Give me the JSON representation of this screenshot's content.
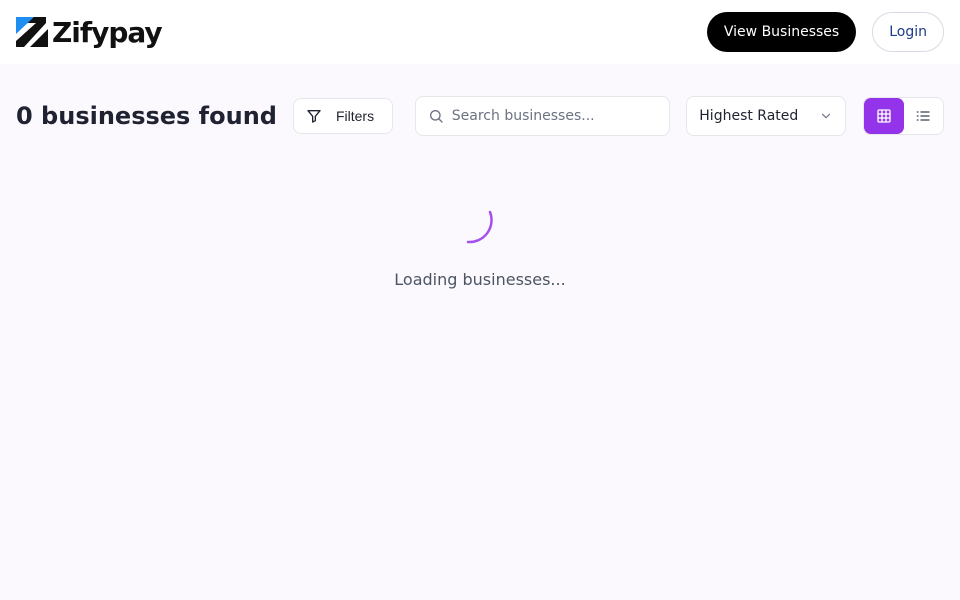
{
  "brand": {
    "name": "Zifypay",
    "icon": "zifypay-logo-icon",
    "colors": {
      "mark_blue": "#1e8ef0",
      "mark_dark": "#111111"
    }
  },
  "header": {
    "view_businesses_label": "View Businesses",
    "login_label": "Login"
  },
  "toolbar": {
    "result_count": "0 businesses found",
    "filters_label": "Filters",
    "filters_icon": "filter-icon",
    "search_placeholder": "Search businesses...",
    "search_value": "",
    "search_icon": "search-icon",
    "sort_selected": "Highest Rated",
    "sort_icon": "chevron-down-icon",
    "view_mode": "grid",
    "grid_icon": "grid-icon",
    "list_icon": "list-icon"
  },
  "loading": {
    "text": "Loading businesses...",
    "icon": "spinner-icon"
  },
  "colors": {
    "accent": "#9333ea",
    "background": "#fbf9fe",
    "primary_button": "#000000"
  }
}
